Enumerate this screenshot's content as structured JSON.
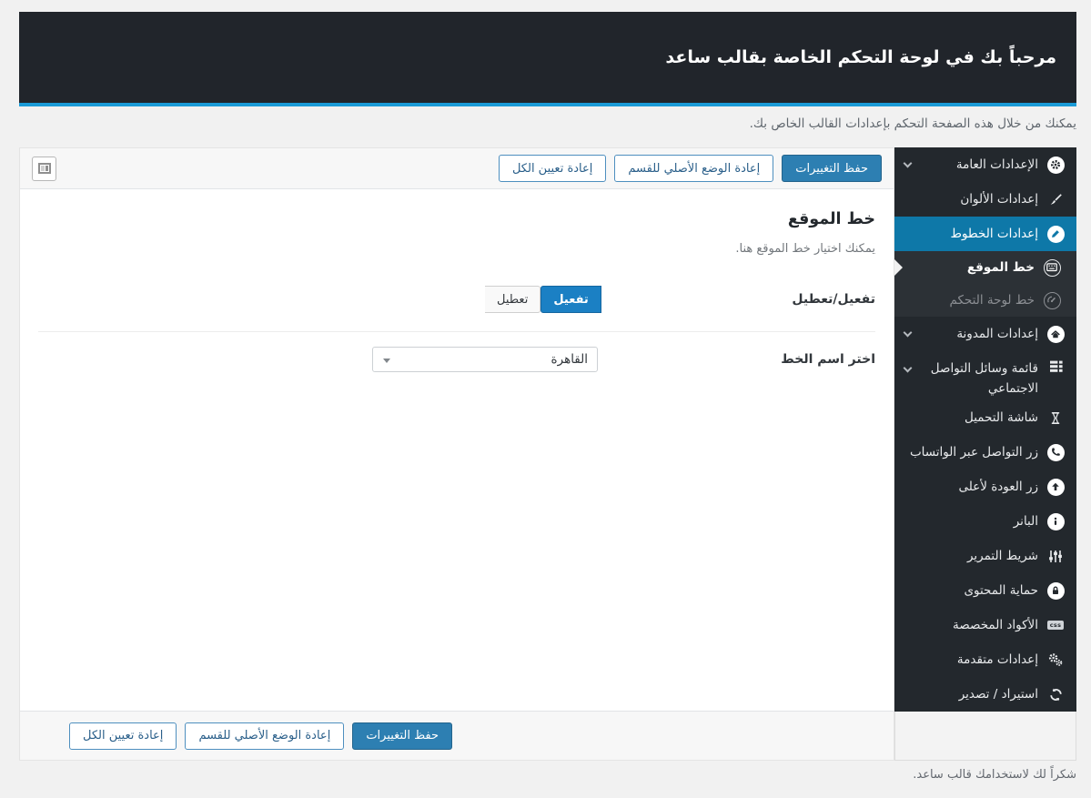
{
  "header": {
    "title": "مرحباً بك في لوحة التحكم الخاصة بقالب ساعد",
    "subtitle": "يمكنك من خلال هذه الصفحة التحكم بإعدادات القالب الخاص بك."
  },
  "toolbar": {
    "save_label": "حفظ التغييرات",
    "reset_section_label": "إعادة الوضع الأصلي للقسم",
    "reset_all_label": "إعادة تعيين الكل"
  },
  "section": {
    "title": "خط الموقع",
    "description": "يمكنك اختيار خط الموقع هنا.",
    "toggle_label": "تفعيل/تعطيل",
    "toggle_on_label": "تفعيل",
    "toggle_off_label": "تعطيل",
    "font_label": "اختر اسم الخط",
    "font_selected_value": "القاهرة"
  },
  "sidebar": {
    "items": [
      {
        "label": "الإعدادات العامة",
        "icon": "gear-circle-icon",
        "expandable": true
      },
      {
        "label": "إعدادات الألوان",
        "icon": "paintbrush-icon"
      },
      {
        "label": "إعدادات الخطوط",
        "icon": "pencil-circle-icon",
        "active": true
      },
      {
        "label": "خط الموقع",
        "icon": "keyboard-circle-icon",
        "submenu": true,
        "current": true
      },
      {
        "label": "خط لوحة التحكم",
        "icon": "dashboard-icon",
        "submenu": true,
        "muted": true
      },
      {
        "label": "إعدادات المدونة",
        "icon": "home-circle-icon",
        "expandable": true
      },
      {
        "label": "قائمة وسائل التواصل الاجتماعي",
        "icon": "social-list-icon",
        "expandable": true
      },
      {
        "label": "شاشة التحميل",
        "icon": "hourglass-icon"
      },
      {
        "label": "زر التواصل عبر الواتساب",
        "icon": "phone-circle-icon"
      },
      {
        "label": "زر العودة لأعلى",
        "icon": "arrow-up-circle-icon"
      },
      {
        "label": "البانر",
        "icon": "info-circle-icon"
      },
      {
        "label": "شريط التمرير",
        "icon": "sliders-icon"
      },
      {
        "label": "حماية المحتوى",
        "icon": "lock-circle-icon"
      },
      {
        "label": "الأكواد المخصصة",
        "icon": "css-badge-icon"
      },
      {
        "label": "إعدادات متقدمة",
        "icon": "gears-icon"
      },
      {
        "label": "استيراد / تصدير",
        "icon": "import-export-icon"
      }
    ],
    "css_badge_text": "css"
  },
  "footer": {
    "thanks": "شكراً لك لاستخدامك قالب ساعد."
  },
  "colors": {
    "header_bg": "#21252b",
    "accent_line_blue": "#1a9bd7",
    "sidebar_bg": "#23282d",
    "sidebar_active_blue": "#0e78a8",
    "primary_button_blue": "#2d7fb2",
    "toggle_active_blue": "#1b80c4",
    "page_bg": "#f1f1f1"
  }
}
